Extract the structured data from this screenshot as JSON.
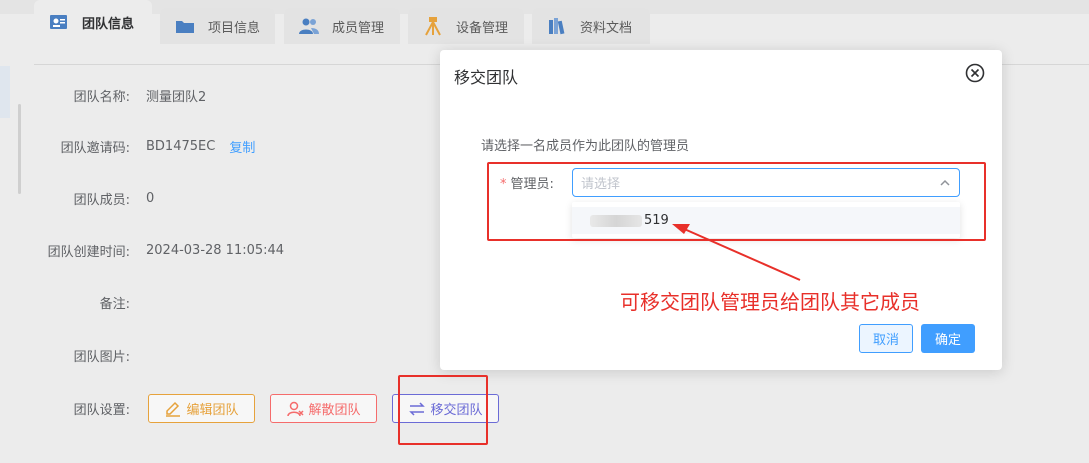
{
  "tabs": [
    {
      "label": "团队信息",
      "icon": "team-info-icon"
    },
    {
      "label": "项目信息",
      "icon": "folder-icon"
    },
    {
      "label": "成员管理",
      "icon": "members-icon"
    },
    {
      "label": "设备管理",
      "icon": "tripod-icon"
    },
    {
      "label": "资料文档",
      "icon": "books-icon"
    }
  ],
  "info": {
    "name_label": "团队名称:",
    "name_value": "测量团队2",
    "code_label": "团队邀请码:",
    "code_value": "BD1475EC",
    "copy_label": "复制",
    "members_label": "团队成员:",
    "members_value": "0",
    "created_label": "团队创建时间:",
    "created_value": "2024-03-28 11:05:44",
    "remark_label": "备注:",
    "image_label": "团队图片:",
    "settings_label": "团队设置:"
  },
  "actions": {
    "edit": "编辑团队",
    "dissolve": "解散团队",
    "transfer": "移交团队"
  },
  "dialog": {
    "title": "移交团队",
    "hint": "请选择一名成员作为此团队的管理员",
    "field_label": "管理员:",
    "placeholder": "请选择",
    "option_suffix": "519",
    "cancel": "取消",
    "confirm": "确定"
  },
  "annotation": "可移交团队管理员给团队其它成员",
  "colors": {
    "primary": "#409eff",
    "edit": "#e6a23c",
    "dissolve": "#f56c6c",
    "transfer": "#6b6bd6",
    "annotation": "#e8302a"
  }
}
